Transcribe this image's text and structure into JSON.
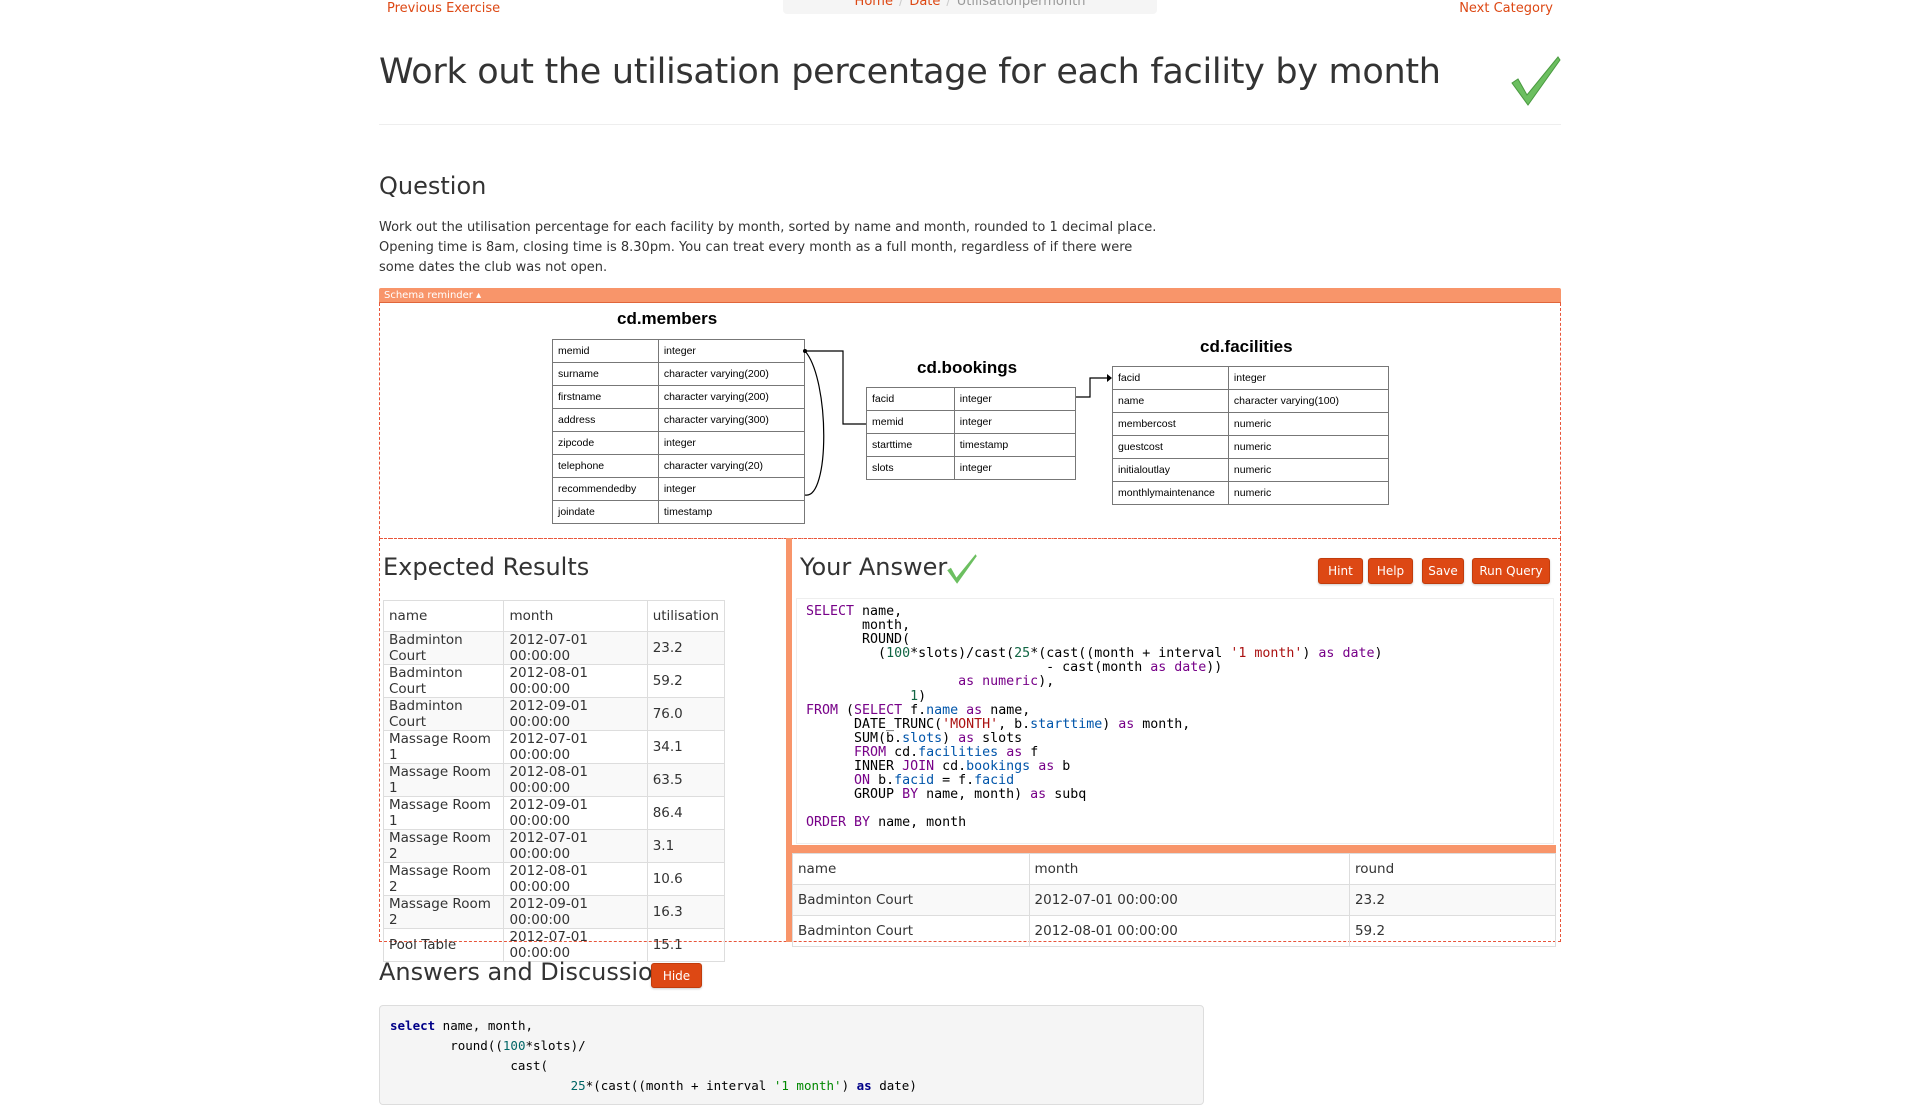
{
  "nav": {
    "previous": "Previous Exercise",
    "next": "Next Category",
    "breadcrumb": [
      "Home",
      "Date",
      "Utilisationpermonth"
    ]
  },
  "title": "Work out the utilisation percentage for each facility by month",
  "question": {
    "heading": "Question",
    "text": "Work out the utilisation percentage for each facility by month, sorted by name and month, rounded to 1 decimal place. Opening time is 8am, closing time is 8.30pm. You can treat every month as a full month, regardless of if there were some dates the club was not open."
  },
  "schema": {
    "toggle": "Schema reminder ▴",
    "tables": [
      {
        "name": "cd.members",
        "rows": [
          [
            "memid",
            "integer"
          ],
          [
            "surname",
            "character varying(200)"
          ],
          [
            "firstname",
            "character varying(200)"
          ],
          [
            "address",
            "character varying(300)"
          ],
          [
            "zipcode",
            "integer"
          ],
          [
            "telephone",
            "character varying(20)"
          ],
          [
            "recommendedby",
            "integer"
          ],
          [
            "joindate",
            "timestamp"
          ]
        ]
      },
      {
        "name": "cd.bookings",
        "rows": [
          [
            "facid",
            "integer"
          ],
          [
            "memid",
            "integer"
          ],
          [
            "starttime",
            "timestamp"
          ],
          [
            "slots",
            "integer"
          ]
        ]
      },
      {
        "name": "cd.facilities",
        "rows": [
          [
            "facid",
            "integer"
          ],
          [
            "name",
            "character varying(100)"
          ],
          [
            "membercost",
            "numeric"
          ],
          [
            "guestcost",
            "numeric"
          ],
          [
            "initialoutlay",
            "numeric"
          ],
          [
            "monthlymaintenance",
            "numeric"
          ]
        ]
      }
    ]
  },
  "expected": {
    "heading": "Expected Results",
    "columns": [
      "name",
      "month",
      "utilisation"
    ],
    "rows": [
      [
        "Badminton Court",
        "2012-07-01 00:00:00",
        "23.2"
      ],
      [
        "Badminton Court",
        "2012-08-01 00:00:00",
        "59.2"
      ],
      [
        "Badminton Court",
        "2012-09-01 00:00:00",
        "76.0"
      ],
      [
        "Massage Room 1",
        "2012-07-01 00:00:00",
        "34.1"
      ],
      [
        "Massage Room 1",
        "2012-08-01 00:00:00",
        "63.5"
      ],
      [
        "Massage Room 1",
        "2012-09-01 00:00:00",
        "86.4"
      ],
      [
        "Massage Room 2",
        "2012-07-01 00:00:00",
        "3.1"
      ],
      [
        "Massage Room 2",
        "2012-08-01 00:00:00",
        "10.6"
      ],
      [
        "Massage Room 2",
        "2012-09-01 00:00:00",
        "16.3"
      ],
      [
        "Pool Table",
        "2012-07-01 00:00:00",
        "15.1"
      ]
    ]
  },
  "answer": {
    "heading": "Your Answer",
    "buttons": {
      "hint": "Hint",
      "help": "Help",
      "save": "Save",
      "run": "Run Query"
    },
    "query": "SELECT name,\n       month,\n       ROUND(\n         (100*slots)/cast(25*(cast((month + interval '1 month') as date)\n                              - cast(month as date))\n                   as numeric),\n             1)\nFROM (SELECT f.name as name,\n      DATE_TRUNC('MONTH', b.starttime) as month,\n      SUM(b.slots) as slots\n      FROM cd.facilities as f\n      INNER JOIN cd.bookings as b\n      ON b.facid = f.facid\n      GROUP BY name, month) as subq\n\nORDER BY name, month",
    "columns": [
      "name",
      "month",
      "round"
    ],
    "rows": [
      [
        "Badminton Court",
        "2012-07-01 00:00:00",
        "23.2"
      ],
      [
        "Badminton Court",
        "2012-08-01 00:00:00",
        "59.2"
      ]
    ]
  },
  "discussion": {
    "heading": "Answers and Discussion",
    "hide": "Hide",
    "code": "select name, month,\n        round((100*slots)/\n                cast(\n                        25*(cast((month + interval '1 month') as date)"
  },
  "colors": {
    "accent": "#dd4814",
    "schema_bar": "#f8956a",
    "check": "#5cb85c"
  }
}
